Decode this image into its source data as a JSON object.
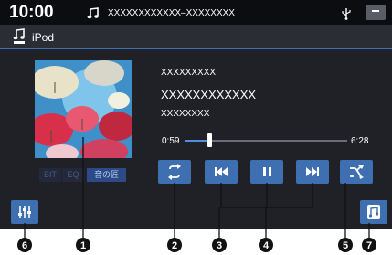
{
  "status": {
    "time": "10:00",
    "track_text": "XXXXXXXXXXXX–XXXXXXXX",
    "icons": [
      "music-note-icon",
      "usb-icon",
      "menu-icon"
    ]
  },
  "source": {
    "label": "iPod"
  },
  "track": {
    "line1": "XXXXXXXXX",
    "line2": "XXXXXXXXXXXX",
    "line3": "XXXXXXXX"
  },
  "playback": {
    "elapsed": "0:59",
    "total": "6:28",
    "progress_fraction": 0.152
  },
  "chips": {
    "bit": "BIT",
    "eq": "EQ",
    "oto": "音の匠"
  },
  "controls": [
    "repeat-icon",
    "previous-icon",
    "pause-icon",
    "next-icon",
    "shuffle-icon",
    "equalizer-settings-icon",
    "music-library-icon"
  ],
  "callouts": {
    "c1": "1",
    "c2": "2",
    "c3": "3",
    "c4": "4",
    "c5": "5",
    "c6": "6",
    "c7": "7"
  },
  "colors": {
    "accent": "#3d6fb1",
    "background": "#1f2127",
    "progress": "#4f8ee0"
  }
}
